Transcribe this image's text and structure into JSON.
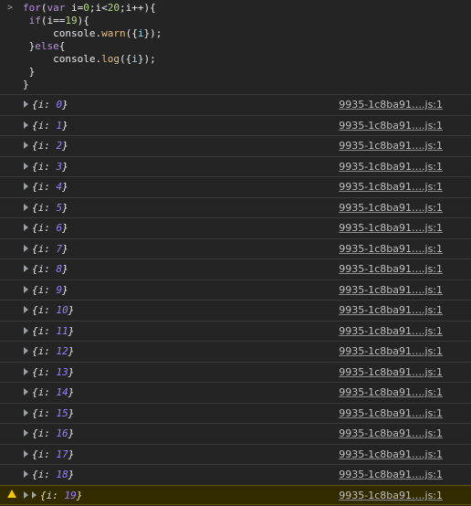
{
  "console": {
    "prompt_glyph": ">",
    "input_code": [
      "for(var i=0;i<20;i++){",
      " if(i==19){",
      "     console.warn({i});",
      " }else{",
      "     console.log({i});",
      " }",
      "}"
    ],
    "logs": [
      {
        "key": "i",
        "value": "0",
        "source": "9935-1c8ba91….js:1"
      },
      {
        "key": "i",
        "value": "1",
        "source": "9935-1c8ba91….js:1"
      },
      {
        "key": "i",
        "value": "2",
        "source": "9935-1c8ba91….js:1"
      },
      {
        "key": "i",
        "value": "3",
        "source": "9935-1c8ba91….js:1"
      },
      {
        "key": "i",
        "value": "4",
        "source": "9935-1c8ba91….js:1"
      },
      {
        "key": "i",
        "value": "5",
        "source": "9935-1c8ba91….js:1"
      },
      {
        "key": "i",
        "value": "6",
        "source": "9935-1c8ba91….js:1"
      },
      {
        "key": "i",
        "value": "7",
        "source": "9935-1c8ba91….js:1"
      },
      {
        "key": "i",
        "value": "8",
        "source": "9935-1c8ba91….js:1"
      },
      {
        "key": "i",
        "value": "9",
        "source": "9935-1c8ba91….js:1"
      },
      {
        "key": "i",
        "value": "10",
        "source": "9935-1c8ba91….js:1"
      },
      {
        "key": "i",
        "value": "11",
        "source": "9935-1c8ba91….js:1"
      },
      {
        "key": "i",
        "value": "12",
        "source": "9935-1c8ba91….js:1"
      },
      {
        "key": "i",
        "value": "13",
        "source": "9935-1c8ba91….js:1"
      },
      {
        "key": "i",
        "value": "14",
        "source": "9935-1c8ba91….js:1"
      },
      {
        "key": "i",
        "value": "15",
        "source": "9935-1c8ba91….js:1"
      },
      {
        "key": "i",
        "value": "16",
        "source": "9935-1c8ba91….js:1"
      },
      {
        "key": "i",
        "value": "17",
        "source": "9935-1c8ba91….js:1"
      },
      {
        "key": "i",
        "value": "18",
        "source": "9935-1c8ba91….js:1"
      }
    ],
    "warning": {
      "key": "i",
      "value": "19",
      "source": "9935-1c8ba91….js:1",
      "icon": "warning-triangle-icon"
    },
    "colors": {
      "background": "#242424",
      "warning_background": "#332b00",
      "warning_icon": "#f2c500",
      "number_value": "#9980ff"
    }
  }
}
